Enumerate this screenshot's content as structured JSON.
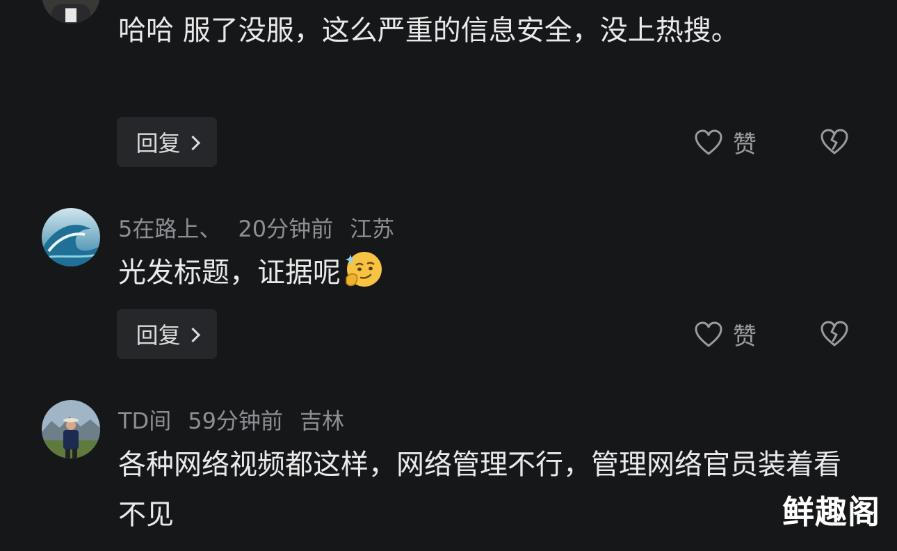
{
  "comments": [
    {
      "user": "",
      "time": "",
      "location": "",
      "text": "哈哈 服了没服，这么严重的信息安全，没上热搜。",
      "reply_label": "回复",
      "like_label": "赞"
    },
    {
      "user": "5在路上、",
      "time": "20分钟前",
      "location": "江苏",
      "text": "光发标题，证据呢",
      "reply_label": "回复",
      "like_label": "赞"
    },
    {
      "user": "TD间",
      "time": "59分钟前",
      "location": "吉林",
      "text": "各种网络视频都这样，网络管理不行，管理网络官员装着看不见"
    }
  ],
  "icons": {
    "like": "heart-outline-icon",
    "dislike": "broken-heart-icon",
    "reply_arrow": "chevron-right-icon",
    "emoji": "thinking-smirk-emoji"
  },
  "colors": {
    "background": "#161719",
    "text": "#eaeaea",
    "meta": "#8d8f94",
    "button_bg": "#26272a"
  },
  "watermark": "鲜趣阁"
}
